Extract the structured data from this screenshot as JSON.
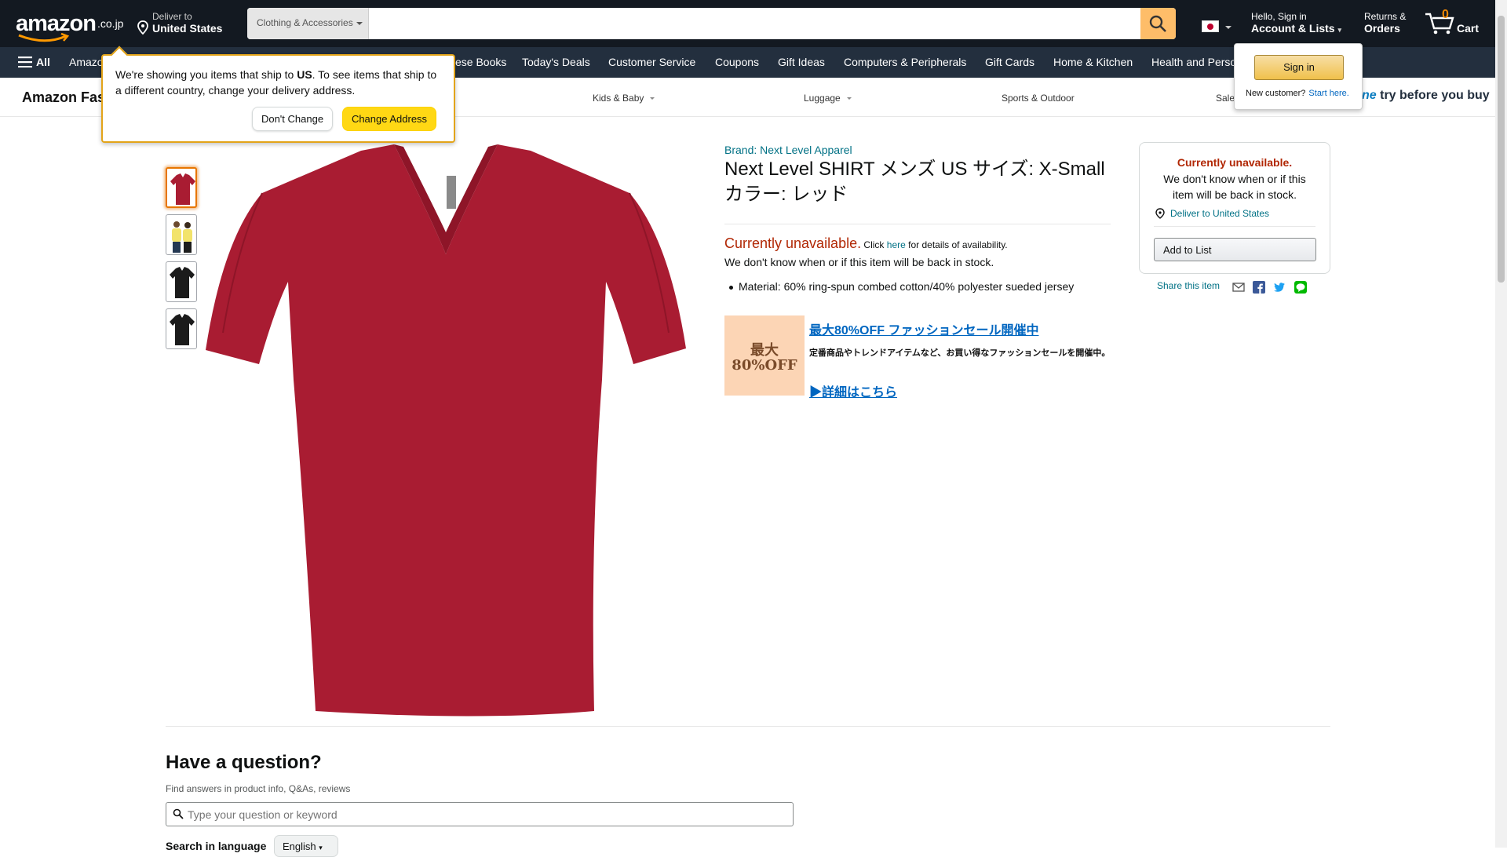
{
  "header": {
    "logo_text": "amazon",
    "logo_tld": ".co.jp",
    "deliver_line1": "Deliver to",
    "deliver_line2": "United States",
    "search_category": "Clothing & Accessories",
    "search_placeholder": "",
    "account_line1": "Hello, Sign in",
    "account_line2": "Account & Lists",
    "returns_line1": "Returns &",
    "returns_line2": "Orders",
    "cart_count": "0",
    "cart_label": "Cart",
    "brand_color": "#131921",
    "search_button_color": "#febd69"
  },
  "subnav": {
    "all_label": "All",
    "items": [
      "Amazon",
      "ese Books",
      "Today's Deals",
      "Customer Service",
      "Coupons",
      "Gift Ideas",
      "Computers & Peripherals",
      "Gift Cards",
      "Home & Kitchen",
      "Health and Perso"
    ]
  },
  "fashion_bar": {
    "brand": "Amazon Fas",
    "links": [
      "Kids & Baby",
      "Luggage",
      "Sports & Outdoor",
      "Sale"
    ],
    "promo_prefix": "ne",
    "promo_text": " try before you buy"
  },
  "ship_popover": {
    "message_pre": "We're showing you items that ship to ",
    "message_country": "US",
    "message_post": ". To see items that ship to a different country, change your delivery address.",
    "dont_change": "Don't Change",
    "change_address": "Change Address"
  },
  "signin_popover": {
    "button": "Sign in",
    "new_customer": "New customer?",
    "start_here": "Start here."
  },
  "product": {
    "brand": "Brand: Next Level Apparel",
    "title": "Next Level SHIRT メンズ US サイズ: X-Small カラー: レッド",
    "unavailable": "Currently unavailable.",
    "click": " Click ",
    "here": "here",
    "details": " for details of availability.",
    "not_know": "We don't know when or if this item will be back in stock.",
    "bullet": "Material: 60% ring-spun combed cotton/40% polyester sueded jersey",
    "shirt_color": "#a91c32",
    "thumbnails": [
      "red-vneck",
      "yellow-models",
      "black-vneck",
      "black-vneck-2"
    ]
  },
  "sale_banner": {
    "badge_line1": "最大",
    "badge_line2": "80%OFF",
    "headline": "最大80%OFF ファッションセール開催中",
    "description": "定番商品やトレンドアイテムなど、お買い得なファッションセールを開催中。",
    "more": "▶詳細はこちら"
  },
  "buybox": {
    "unavailable": "Currently unavailable.",
    "desc": "We don't know when or if this item will be back in stock.",
    "deliver": "Deliver to United States",
    "add_to_list": "Add to List",
    "share_label": "Share this item"
  },
  "question": {
    "heading": "Have a question?",
    "sub": "Find answers in product info, Q&As, reviews",
    "placeholder": "Type your question or keyword",
    "lang_label": "Search in language",
    "lang_value": "English"
  }
}
